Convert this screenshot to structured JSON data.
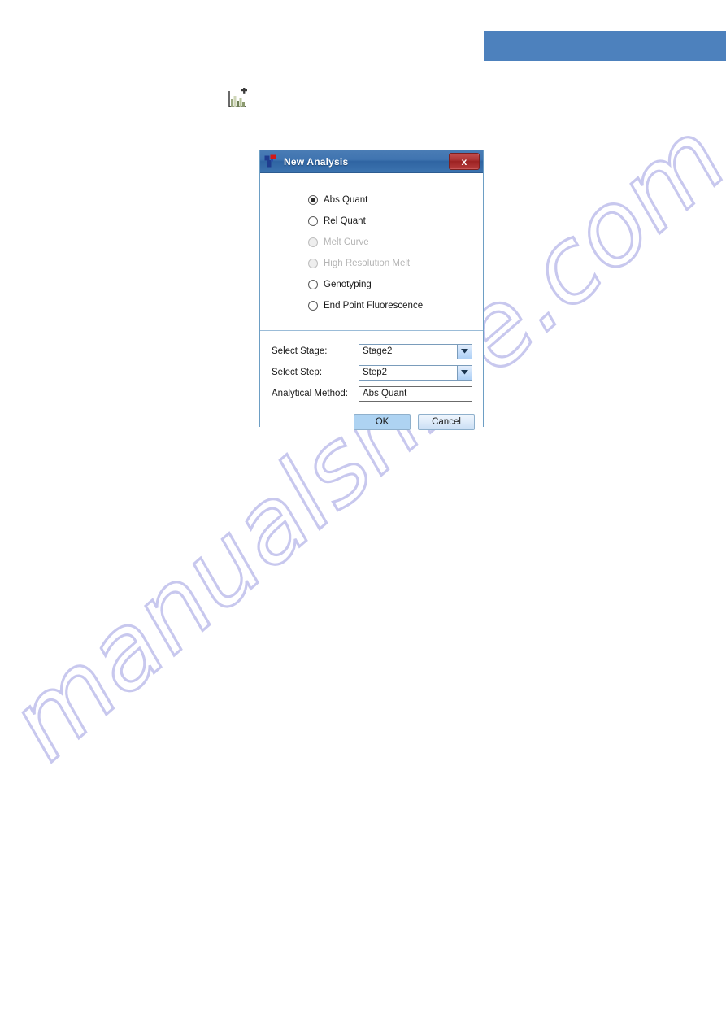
{
  "page": {
    "watermark_text": "manualshive.com",
    "watermark_color": "#c8c8ee",
    "banner_color": "#4d81bd"
  },
  "toolbar": {
    "new_analysis_icon": "new-analysis-chart-icon"
  },
  "dialog": {
    "title": "New Analysis",
    "title_icon": "analysis-app-icon",
    "close_label": "x",
    "analysis_types": [
      {
        "label": "Abs Quant",
        "selected": true,
        "disabled": false
      },
      {
        "label": "Rel Quant",
        "selected": false,
        "disabled": false
      },
      {
        "label": "Melt Curve",
        "selected": false,
        "disabled": true
      },
      {
        "label": "High Resolution Melt",
        "selected": false,
        "disabled": true
      },
      {
        "label": "Genotyping",
        "selected": false,
        "disabled": false
      },
      {
        "label": "End Point Fluorescence",
        "selected": false,
        "disabled": false
      }
    ],
    "fields": {
      "stage_label": "Select Stage:",
      "stage_value": "Stage2",
      "step_label": "Select Step:",
      "step_value": "Step2",
      "method_label": "Analytical Method:",
      "method_value": "Abs Quant"
    },
    "buttons": {
      "ok": "OK",
      "cancel": "Cancel"
    }
  }
}
